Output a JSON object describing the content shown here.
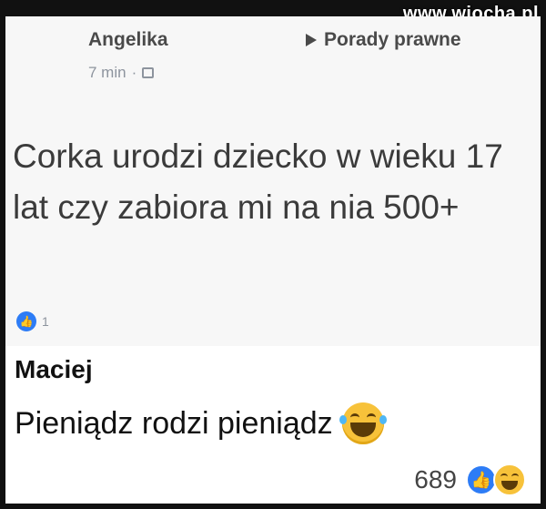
{
  "watermark": "www.wiocha.pl",
  "post": {
    "author": "Angelika",
    "time": "7 min",
    "separator": "·",
    "group": "Porady prawne",
    "text": "Corka urodzi dziecko w wieku 17 lat czy zabiora mi na nia 500+",
    "like_count": "1"
  },
  "comment": {
    "author": "Maciej",
    "text": "Pieniądz rodzi pieniądz",
    "reaction_count": "689"
  },
  "colors": {
    "like_blue": "#2d7cf6",
    "haha_yellow": "#f7c23a"
  }
}
